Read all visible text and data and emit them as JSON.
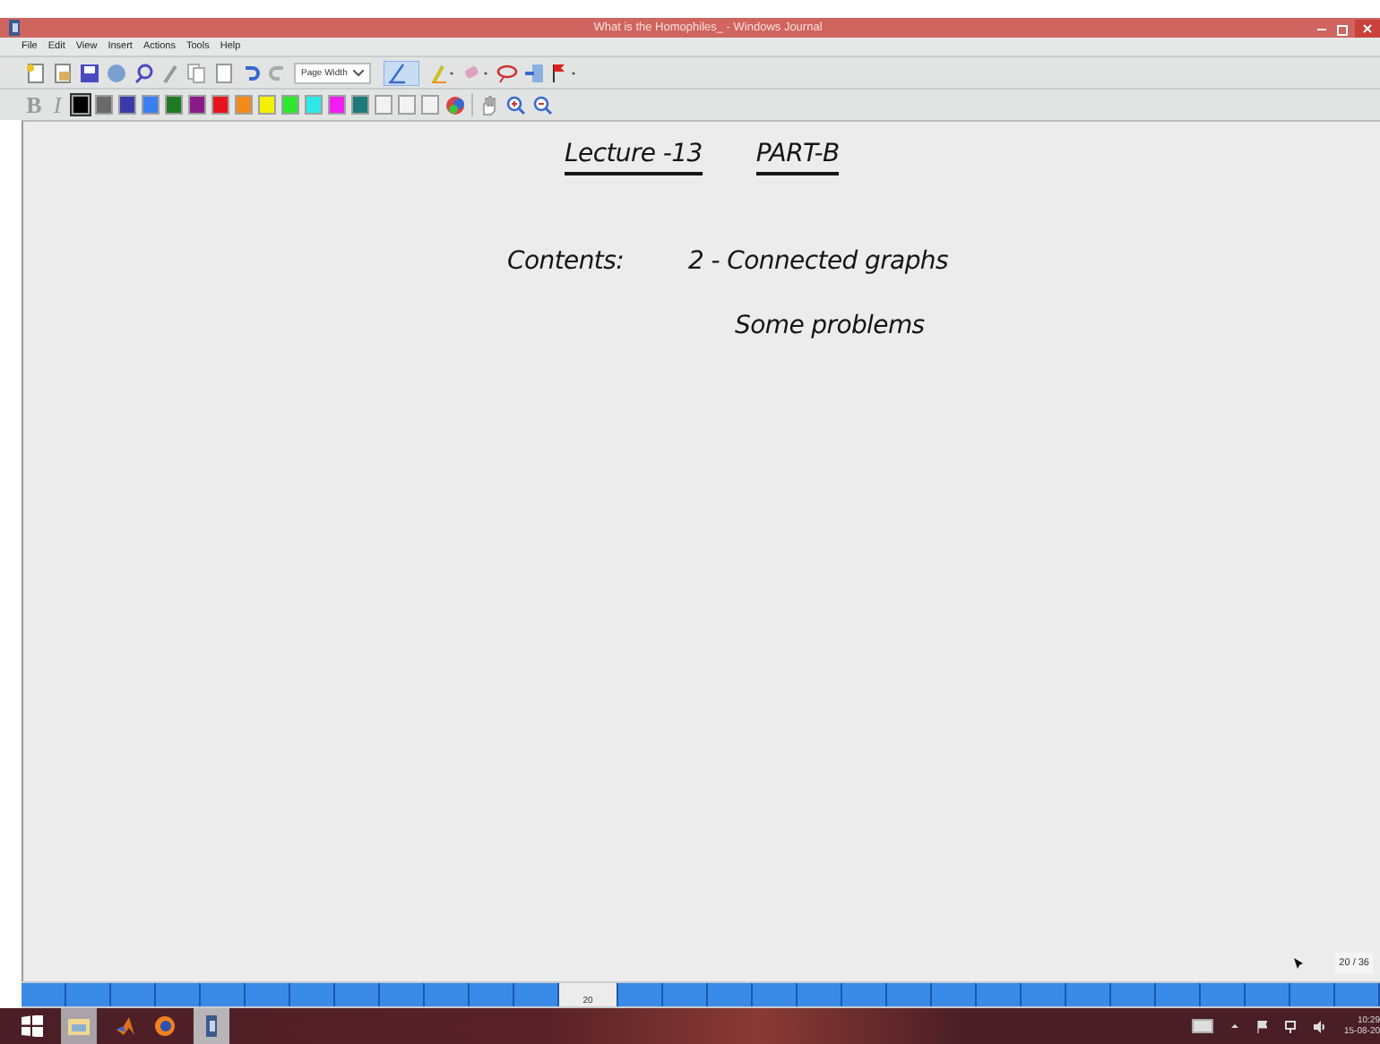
{
  "window": {
    "title": "What is the Homophiles_ - Windows Journal"
  },
  "menu": [
    "File",
    "Edit",
    "View",
    "Insert",
    "Actions",
    "Tools",
    "Help"
  ],
  "zoom_dropdown": {
    "value": "Page Width"
  },
  "format_buttons": [
    {
      "kind": "bold",
      "label": "B"
    },
    {
      "kind": "italic",
      "label": "I"
    }
  ],
  "colors": [
    {
      "color": "#000000",
      "selected": true
    },
    {
      "color": "#6a6a6a",
      "selected": false
    },
    {
      "color": "#3a3aa8",
      "selected": false
    },
    {
      "color": "#3a7ef0",
      "selected": false
    },
    {
      "color": "#1f7a24",
      "selected": false
    },
    {
      "color": "#8a1a8a",
      "selected": false
    },
    {
      "color": "#e8141c",
      "selected": false
    },
    {
      "color": "#f48a1c",
      "selected": false
    },
    {
      "color": "#f4f000",
      "selected": false
    },
    {
      "color": "#2ee82e",
      "selected": false
    },
    {
      "color": "#2ee8e8",
      "selected": false
    },
    {
      "color": "#f01cf0",
      "selected": false
    },
    {
      "color": "#1c7a78",
      "selected": false
    },
    {
      "color": "#f2f2f2",
      "selected": false
    },
    {
      "color": "#f2f2f2",
      "selected": false
    },
    {
      "color": "#f2f2f2",
      "selected": false
    }
  ],
  "note": {
    "heading": "Lecture -13",
    "part": "PART-B",
    "contents_label": "Contents:",
    "items": [
      "2 - Connected graphs",
      "Some problems"
    ]
  },
  "page_counter": "20 / 36",
  "page_tabs": {
    "current": "20"
  },
  "taskbar": {
    "time": "10:29",
    "date": "15-08-20"
  }
}
